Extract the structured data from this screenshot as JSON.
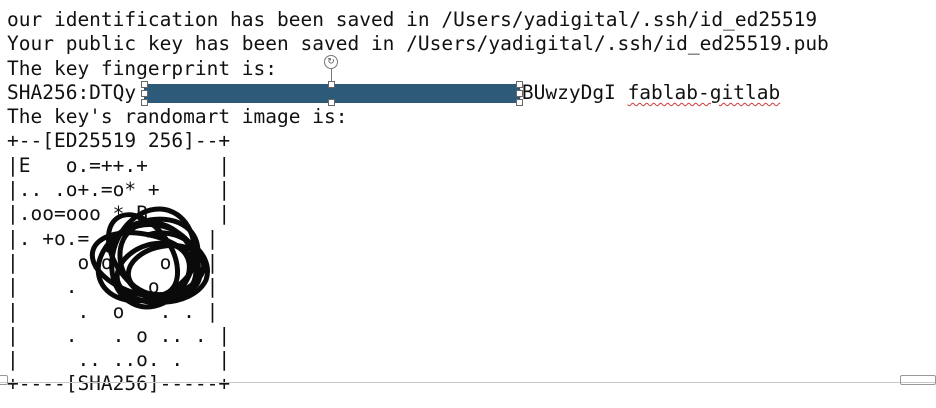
{
  "document": {
    "lines": [
      "our identification has been saved in /Users/yadigital/.ssh/id_ed25519",
      "Your public key has been saved in /Users/yadigital/.ssh/id_ed25519.pub",
      "The key fingerprint is:",
      {
        "prefix": "SHA256:DTQy",
        "suffix": "cBUwzyDgI",
        "comment": "fablab-gitlab"
      },
      "The key's randomart image is:",
      "+--[ED25519 256]--+",
      "|E   o.=++.+      |",
      "|.. .o+.=o* +     |",
      "|.oo=ooo * B      |",
      "|. +o.=          |",
      "|     o.o    o.  |",
      "|    .  .   o  . |",
      "|     .  o   . . |",
      "|    .   . o .. . |",
      "|     .. ..o. .   |",
      "+----[SHA256]-----+"
    ]
  },
  "annotations": {
    "redaction_color": "#2e5a7a",
    "scribble": "handwritten-scribble-over-randomart"
  }
}
